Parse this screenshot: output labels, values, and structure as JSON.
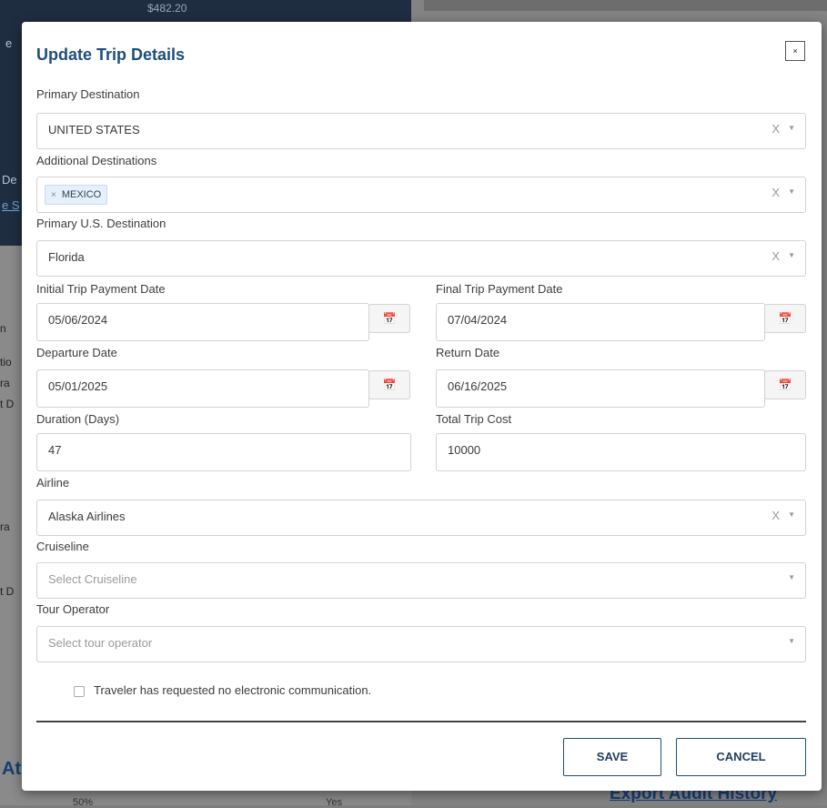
{
  "background": {
    "amount": "$482.20",
    "fragment_e": "e",
    "fragment_de": "De",
    "fragment_s": "e S",
    "side_fragments": [
      "n",
      "tio",
      "ra",
      "t D",
      "ra",
      "t D"
    ],
    "at": "At",
    "export_link": "Export Audit History",
    "percent": "50%",
    "yes": "Yes"
  },
  "modal": {
    "title": "Update Trip Details",
    "close_label": "×",
    "primary_destination": {
      "label": "Primary Destination",
      "value": "UNITED STATES",
      "clear": "X",
      "caret": "▼"
    },
    "additional_destinations": {
      "label": "Additional Destinations",
      "tags": [
        {
          "remove": "×",
          "text": "MEXICO"
        }
      ],
      "clear": "X",
      "caret": "▼"
    },
    "primary_us_destination": {
      "label": "Primary U.S. Destination",
      "value": "Florida",
      "clear": "X",
      "caret": "▼"
    },
    "initial_payment_date": {
      "label": "Initial Trip Payment Date",
      "value": "05/06/2024"
    },
    "final_payment_date": {
      "label": "Final Trip Payment Date",
      "value": "07/04/2024"
    },
    "departure_date": {
      "label": "Departure Date",
      "value": "05/01/2025"
    },
    "return_date": {
      "label": "Return Date",
      "value": "06/16/2025"
    },
    "duration": {
      "label": "Duration (Days)",
      "value": "47"
    },
    "total_cost": {
      "label": "Total Trip Cost",
      "value": "10000"
    },
    "airline": {
      "label": "Airline",
      "value": "Alaska Airlines",
      "clear": "X",
      "caret": "▼"
    },
    "cruiseline": {
      "label": "Cruiseline",
      "placeholder": "Select Cruiseline",
      "caret": "▼"
    },
    "tour_operator": {
      "label": "Tour Operator",
      "placeholder": "Select tour operator",
      "caret": "▼"
    },
    "no_electronic_comm": {
      "label": "Traveler has requested no electronic communication.",
      "checked": false
    },
    "calendar_icon": "📅",
    "save_label": "SAVE",
    "cancel_label": "CANCEL"
  }
}
